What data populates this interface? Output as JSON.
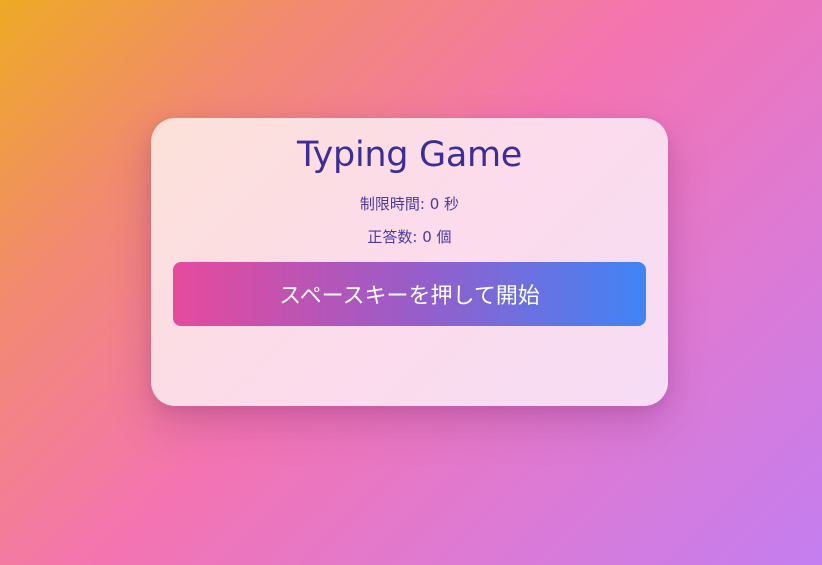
{
  "game": {
    "title": "Typing Game",
    "time_label": "制限時間: 0 秒",
    "score_label": "正答数: 0 個",
    "start_button_label": "スペースキーを押して開始"
  },
  "colors": {
    "title": "#3c2e94",
    "button_gradient_start": "#e64a9c",
    "button_gradient_end": "#3f84f6"
  }
}
